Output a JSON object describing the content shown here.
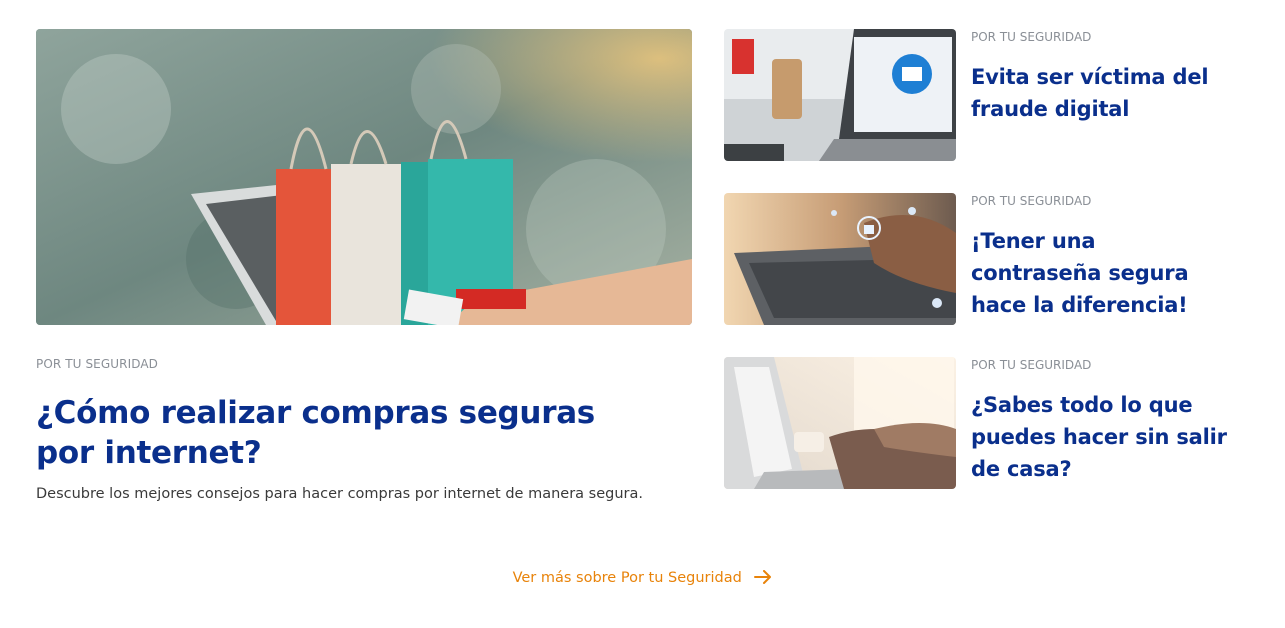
{
  "featured": {
    "category": "POR TU SEGURIDAD",
    "title": "¿Cómo realizar compras seguras por internet?",
    "description": "Descubre los mejores consejos para hacer compras por internet de manera segura.",
    "image_icon": "shopping-bags-laptop-image"
  },
  "side_articles": [
    {
      "category": "POR TU SEGURIDAD",
      "title": "Evita ser víctima del fraude digital",
      "image_icon": "laptop-email-image"
    },
    {
      "category": "POR TU SEGURIDAD",
      "title": "¡Tener una contraseña segura hace la diferencia!",
      "image_icon": "keyboard-security-image"
    },
    {
      "category": "POR TU SEGURIDAD",
      "title": "¿Sabes todo lo que puedes hacer sin salir de casa?",
      "image_icon": "laptop-typing-image"
    }
  ],
  "footer_link": {
    "label": "Ver más sobre Por tu Seguridad",
    "icon": "arrow-right-icon"
  },
  "colors": {
    "title": "#0a2f8c",
    "category": "#8a8f96",
    "link": "#e8830a"
  }
}
